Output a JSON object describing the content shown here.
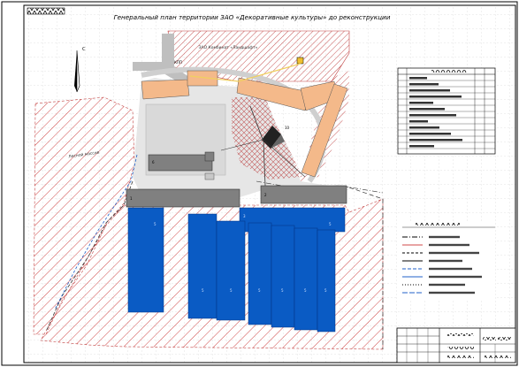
{
  "sheet": {
    "title": "Генеральный план территории ЗАО «Декоративные культуры» до реконструкции"
  },
  "labels": {
    "north_arrow": "С",
    "neighbor_company": "ЗАО Комбинат «Ландшафт»",
    "forest_area": "Лесной массив",
    "kpp": "КПП",
    "building_10": "10",
    "building_1": "1",
    "building_2": "2",
    "building_3": "3",
    "building_6": "6",
    "greenhouse_numbers": [
      "5",
      "5",
      "5",
      "5",
      "5",
      "5",
      "5",
      "5"
    ]
  },
  "colors": {
    "background": "#ffffff",
    "frame": "#000000",
    "grid": "#c8c8c8",
    "hatch_red": "#d04848",
    "building_orange": "#f4b98a",
    "building_gray": "#808080",
    "greenhouse_blue": "#0a5bc4",
    "paved_gray": "#d9d9d9",
    "road_yellow": "#f0d060",
    "water_blue": "#2060c8"
  },
  "icons": [
    "north-arrow-icon",
    "transformer-icon",
    "fence-line-icon"
  ]
}
